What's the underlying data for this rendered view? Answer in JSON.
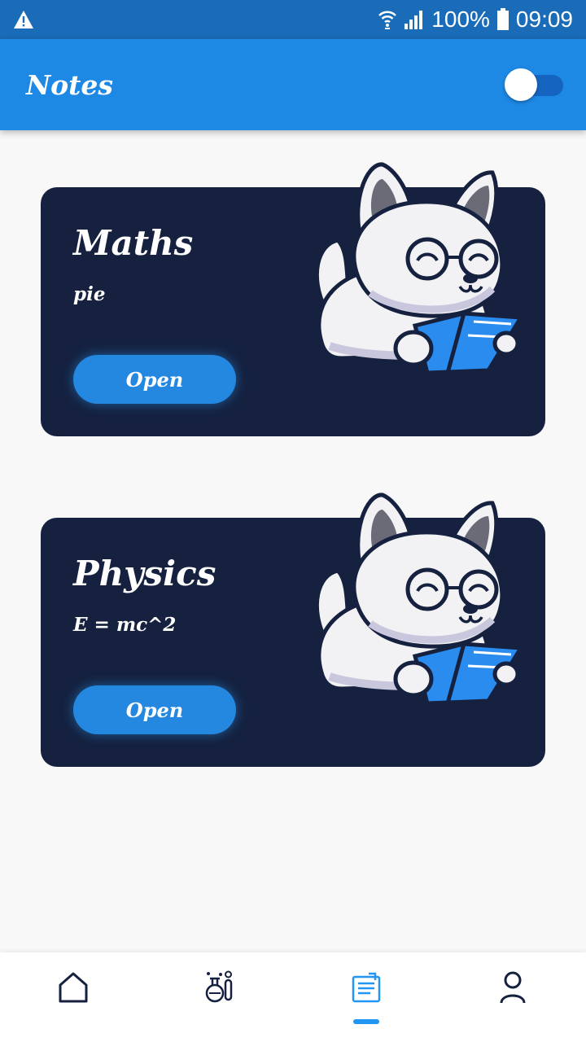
{
  "status_bar": {
    "battery": "100%",
    "time": "09:09",
    "icons": [
      "warning-icon",
      "wifi-icon",
      "signal-icon",
      "battery-icon"
    ]
  },
  "app_bar": {
    "title": "Notes",
    "theme_toggle_on": false
  },
  "cards": [
    {
      "title": "Maths",
      "subtitle": "pie",
      "button": "Open"
    },
    {
      "title": "Physics",
      "subtitle": "E = mc^2",
      "button": "Open"
    }
  ],
  "bottom_nav": {
    "items": [
      {
        "icon": "home-icon"
      },
      {
        "icon": "science-icon"
      },
      {
        "icon": "notes-icon",
        "active": true
      },
      {
        "icon": "profile-icon"
      }
    ]
  },
  "colors": {
    "status_bar": "#1a6bb8",
    "app_bar": "#1e88e5",
    "card": "#15213f",
    "button": "#2488e0",
    "active": "#2196f3"
  }
}
